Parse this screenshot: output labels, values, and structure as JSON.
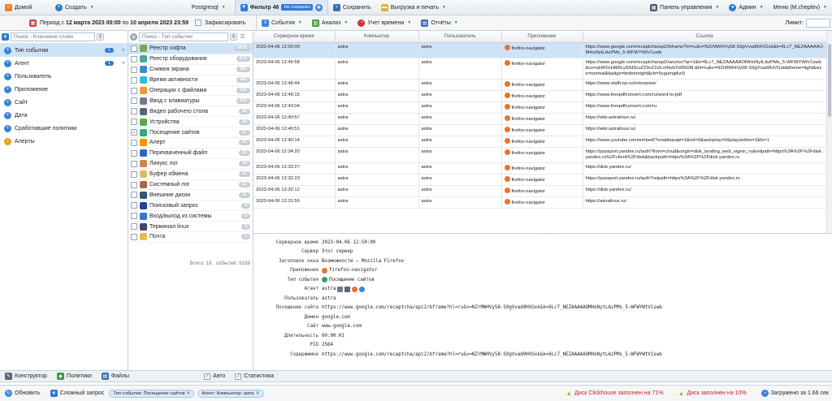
{
  "top": {
    "home": "Домой",
    "create": "Создать",
    "db": "Postgresql",
    "filter_tab": "Фильтр 46",
    "unsaved": "Не сохранен",
    "save": "Сохранить",
    "export": "Выгрузка и печать",
    "dashboard": "Панель управления",
    "admin": "Админ",
    "menu": "Меню (M.cheplev)"
  },
  "period": {
    "label_start": "Период с ",
    "from": "12 марта 2023 00:00",
    "mid": " по ",
    "to": "10 апреля 2023 23:59",
    "fix": "Зафиксировать"
  },
  "sub": {
    "events": "События",
    "analysis": "Анализ",
    "time": "Учет времени",
    "reports": "Отчёты",
    "limit": "Лимит:"
  },
  "left": {
    "search_placeholder": "Поиск - Ключевое слово",
    "items": [
      {
        "label": "Тип события",
        "badge": "1"
      },
      {
        "label": "Агент",
        "badge": "1"
      },
      {
        "label": "Пользователь",
        "badge": ""
      },
      {
        "label": "Приложение",
        "badge": ""
      },
      {
        "label": "Сайт",
        "badge": ""
      },
      {
        "label": "Дата",
        "badge": ""
      },
      {
        "label": "Сработавшие политики",
        "badge": ""
      },
      {
        "label": "Алерты",
        "badge": ""
      }
    ]
  },
  "types": {
    "search_placeholder": "Поиск - Тип события",
    "items": [
      {
        "label": "Реестр софта",
        "count": "6928",
        "color": "#7a5"
      },
      {
        "label": "Реестр оборудования",
        "count": "812",
        "color": "#4a9"
      },
      {
        "label": "Снимок экрана",
        "count": "583",
        "color": "#48c"
      },
      {
        "label": "Время активности",
        "count": "480",
        "color": "#3bc"
      },
      {
        "label": "Операции с файлами",
        "count": "334",
        "color": "#e93"
      },
      {
        "label": "Ввод с клавиатуры",
        "count": "120",
        "color": "#778"
      },
      {
        "label": "Видео рабочего стола",
        "count": "40",
        "color": "#567"
      },
      {
        "label": "Устройства",
        "count": "39",
        "color": "#5a4"
      },
      {
        "label": "Посещение сайтов",
        "count": "27",
        "color": "#3a7"
      },
      {
        "label": "Алерт",
        "count": "22",
        "color": "#e90"
      },
      {
        "label": "Перехваченный файл",
        "count": "20",
        "color": "#36b"
      },
      {
        "label": "Линукс лог",
        "count": "19",
        "color": "#c84"
      },
      {
        "label": "Буфер обмена",
        "count": "12",
        "color": "#db6"
      },
      {
        "label": "Системный лог",
        "count": "11",
        "color": "#a64"
      },
      {
        "label": "Внешние диски",
        "count": "11",
        "color": "#357"
      },
      {
        "label": "Поисковый запрос",
        "count": "8",
        "color": "#249"
      },
      {
        "label": "Вход/выход из системы",
        "count": "5",
        "color": "#37c"
      },
      {
        "label": "Терминал linux",
        "count": "4",
        "color": "#446"
      },
      {
        "label": "Почта",
        "count": "1",
        "color": "#eb4"
      }
    ],
    "total": "Всего: 19 , событий: 9338"
  },
  "grid": {
    "headers": [
      "Серверное время",
      "Компьютер",
      "Пользователь",
      "Приложение",
      "Ссылка"
    ],
    "rows": [
      [
        "2023-04-06 12:50:00",
        "astra",
        "astra",
        "firefox-navigator",
        "https://www.google.com/recaptcha/api2/bframe?hl=ru&v=NZrMWHVy58-S9gVvad9HVGxk&k=6Lc7_NEZAAAAAOMHoNytLAzPMs_5-WFWYWtV1swb"
      ],
      [
        "2023-04-06 12:49:58",
        "astra",
        "astra",
        "firefox-navigator",
        "https://www.google.com/recaptcha/api2/anchor?ar=1&k=6Lc7_NEZAAAAAOMHoNytLAzPMs_5-WFWYWtV1swb&co=aHR0cHM6Ly93d3cuZ29vZ2xlLmNvbTo0NDM.&hl=ru&v=NZrMWHVy58-S9gVvad9HVGxk&theme=light&size=normal&badge=bottomright&cb=5cgumgtkzi3"
      ],
      [
        "2023-04-06 12:49:44",
        "astra",
        "astra",
        "firefox-navigator",
        "https://www.staffcop.ru/enterprise/"
      ],
      [
        "2023-04-06 12:49:15",
        "astra",
        "astra",
        "firefox-navigator",
        "https://www.freepdfconvert.com/ru/word-to-pdf"
      ],
      [
        "2023-04-06 12:43:04",
        "astra",
        "astra",
        "firefox-navigator",
        "https://www.freepdfconvert.com/ru"
      ],
      [
        "2023-04-06 12:40:57",
        "astra",
        "astra",
        "firefox-navigator",
        "https://wiki.astralinux.ru/"
      ],
      [
        "2023-04-06 12:40:51",
        "astra",
        "astra",
        "firefox-navigator",
        "https://wiki.astralinux.ru/"
      ],
      [
        "2023-04-06 12:40:14",
        "astra",
        "astra",
        "firefox-navigator",
        "https://www.youtube.com/embed/?enablejsapi=1&rel=0&autoplay=0&playsinline=1&fs=1"
      ],
      [
        "2023-04-06 12:34:20",
        "astra",
        "astra",
        "firefox-navigator",
        "https://passport.yandex.ru/auth?from=cloud&origin=disk_landing_web_signin_ru&retpath=https%3A%2F%2Fdisk.yandex.ru%2Fclient%2Fdisk&backpath=https%3A%2F%2Fdisk.yandex.ru"
      ],
      [
        "2023-04-06 12:33:27",
        "astra",
        "astra",
        "firefox-navigator",
        "https://disk.yandex.ru/"
      ],
      [
        "2023-04-06 12:32:23",
        "astra",
        "astra",
        "firefox-navigator",
        "https://passport.yandex.ru/auth?retpath=https%3A%2F%2Fdisk.yandex.ru"
      ],
      [
        "2023-04-06 12:32:12",
        "astra",
        "astra",
        "firefox-navigator",
        "https://disk.yandex.ru/"
      ],
      [
        "2023-04-06 12:31:56",
        "astra",
        "astra",
        "firefox-navigator",
        "https://astralinux.ru/"
      ]
    ]
  },
  "detail": [
    {
      "k": "Серверное время",
      "v": "2023-04-06 12:50:00"
    },
    {
      "k": "Сервер",
      "v": "Этот сервер"
    },
    {
      "k": "Заголовок окна",
      "v": "Возможности — Mozilla Firefox"
    },
    {
      "k": "Приложение",
      "v": "firefox-navigator"
    },
    {
      "k": "Тип события",
      "v": "Посещение сайтов"
    },
    {
      "k": "Агент",
      "v": "astra"
    },
    {
      "k": "Пользователь",
      "v": "astra"
    },
    {
      "k": "Посещение сайта",
      "v": "https://www.google.com/recaptcha/api2/bframe?hl=ru&v=NZrMWHVy58-S9gVvad9HVGxk&k=6Lc7_NEZAAAAAOMHoNytLAzPMs_5-WFWYWtV1swb"
    },
    {
      "k": "Домен",
      "v": "google.com"
    },
    {
      "k": "Сайт",
      "v": "www.google.com"
    },
    {
      "k": "Длительность",
      "v": "00:00:01"
    },
    {
      "k": "PID",
      "v": "2564"
    },
    {
      "k": "Содержимое",
      "v": "https://www.google.com/recaptcha/api2/bframe?hl=ru&v=NZrMWHVy58-S9gVvad9HVGxk&k=6Lc7_NEZAAAAAOMHoNytLAzPMs_5-WFWYWtV1swb"
    }
  ],
  "bottom": {
    "constructor": "Конструктор",
    "policies": "Политики",
    "files": "Файлы",
    "auto": "Авто",
    "stats": "Статистика"
  },
  "status": {
    "refresh": "Обновить",
    "complex": "Сложный запрос",
    "chip1": "Тип события: Посещение сайтов",
    "chip2": "Агент: Компьютер: astra",
    "warn1": "Диск Clickhouse заполнен на 71%",
    "warn2": "Диск заполнен на 10%",
    "loaded": "Загружено за 1.66 сек"
  }
}
